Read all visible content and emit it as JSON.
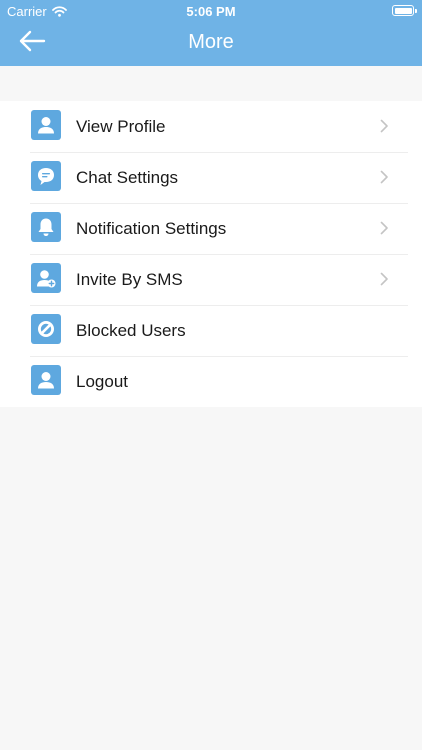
{
  "status_bar": {
    "carrier": "Carrier",
    "time": "5:06 PM"
  },
  "nav": {
    "title": "More"
  },
  "menu": [
    {
      "label": "View Profile",
      "icon": "user-icon",
      "has_chevron": true
    },
    {
      "label": "Chat Settings",
      "icon": "chat-bubble-icon",
      "has_chevron": true
    },
    {
      "label": "Notification Settings",
      "icon": "bell-icon",
      "has_chevron": true
    },
    {
      "label": "Invite By SMS",
      "icon": "add-user-icon",
      "has_chevron": true
    },
    {
      "label": "Blocked Users",
      "icon": "block-icon",
      "has_chevron": false
    },
    {
      "label": "Logout",
      "icon": "user-icon",
      "has_chevron": false
    }
  ],
  "colors": {
    "header": "#6fb3e6",
    "icon_background": "#5ea8df",
    "page_background": "#f7f7f7",
    "chevron": "#c4c4c4"
  }
}
